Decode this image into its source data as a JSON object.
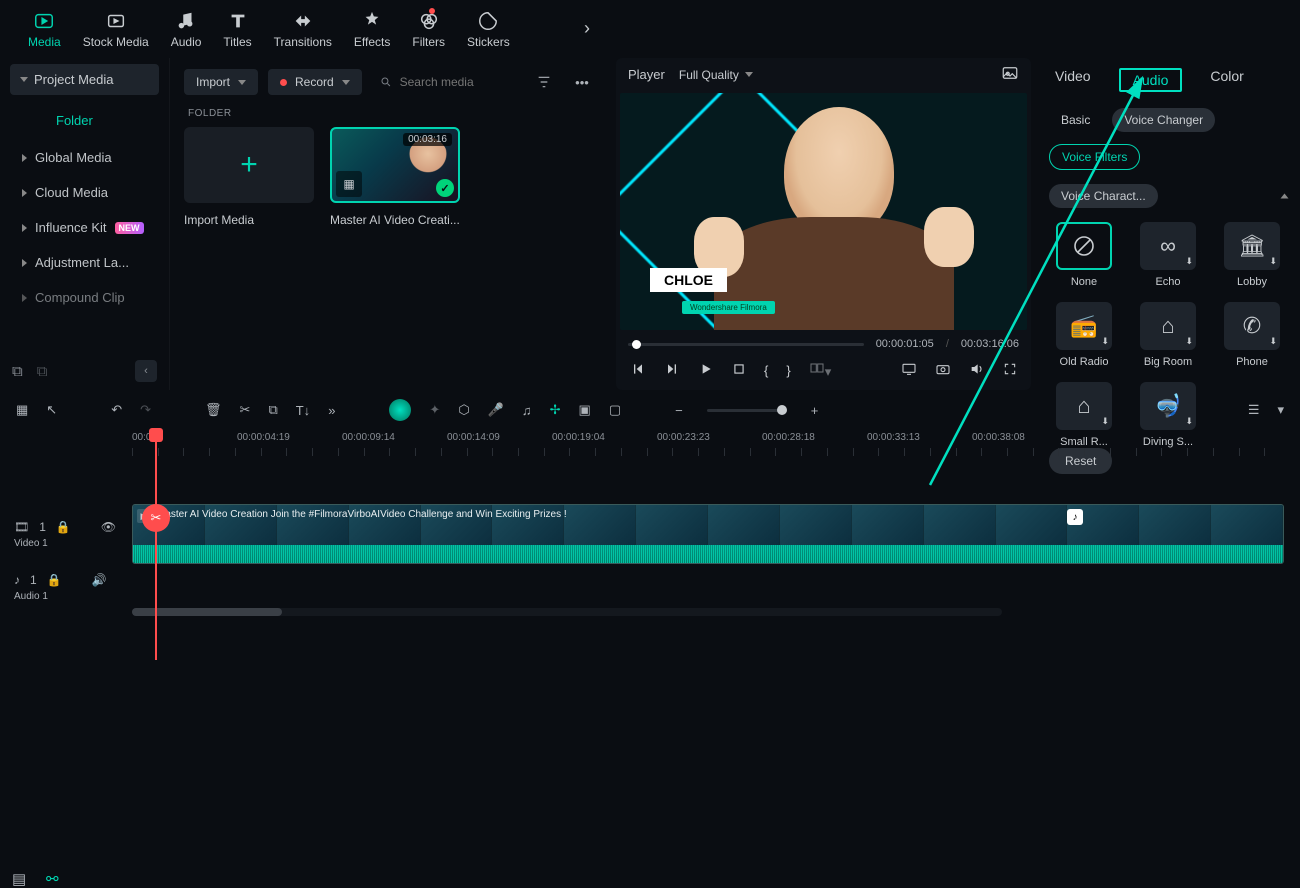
{
  "toolstrip": {
    "items": [
      {
        "label": "Media",
        "active": true
      },
      {
        "label": "Stock Media"
      },
      {
        "label": "Audio"
      },
      {
        "label": "Titles"
      },
      {
        "label": "Transitions"
      },
      {
        "label": "Effects"
      },
      {
        "label": "Filters",
        "dot": true
      },
      {
        "label": "Stickers"
      }
    ]
  },
  "sidebar": {
    "project_media": "Project Media",
    "folder": "Folder",
    "items": [
      {
        "label": "Global Media"
      },
      {
        "label": "Cloud Media"
      },
      {
        "label": "Influence Kit",
        "new": true
      },
      {
        "label": "Adjustment La..."
      },
      {
        "label": "Compound Clip"
      }
    ]
  },
  "browser": {
    "import": "Import",
    "record": "Record",
    "search_placeholder": "Search media",
    "folder_label": "FOLDER",
    "import_card": "Import Media",
    "clip": {
      "duration": "00:03:16",
      "title": "Master AI Video Creati..."
    }
  },
  "player": {
    "label": "Player",
    "quality": "Full Quality",
    "name_overlay": "CHLOE",
    "sub_overlay": "Wondershare Filmora",
    "current": "00:00:01:05",
    "total": "00:03:16:06"
  },
  "inspector": {
    "tabs": [
      "Video",
      "Audio",
      "Color"
    ],
    "active_tab": "Audio",
    "subtabs": {
      "basic": "Basic",
      "voice_changer": "Voice Changer"
    },
    "chips": {
      "voice_filters": "Voice Filters",
      "voice_charact": "Voice Charact..."
    },
    "effects": [
      {
        "label": "None",
        "sel": true
      },
      {
        "label": "Echo"
      },
      {
        "label": "Lobby"
      },
      {
        "label": "Old Radio"
      },
      {
        "label": "Big Room"
      },
      {
        "label": "Phone"
      },
      {
        "label": "Small R..."
      },
      {
        "label": "Diving S..."
      }
    ],
    "reset": "Reset"
  },
  "ruler": [
    "00:00",
    "00:00:04:19",
    "00:00:09:14",
    "00:00:14:09",
    "00:00:19:04",
    "00:00:23:23",
    "00:00:28:18",
    "00:00:33:13",
    "00:00:38:08"
  ],
  "tracks": {
    "video": {
      "name": "Video 1",
      "badge": "1"
    },
    "audio": {
      "name": "Audio 1",
      "badge": "1"
    },
    "clip_label": "Master AI Video Creation   Join the #FilmoraVirboAIVideo  Challenge and Win Exciting Prizes !"
  }
}
